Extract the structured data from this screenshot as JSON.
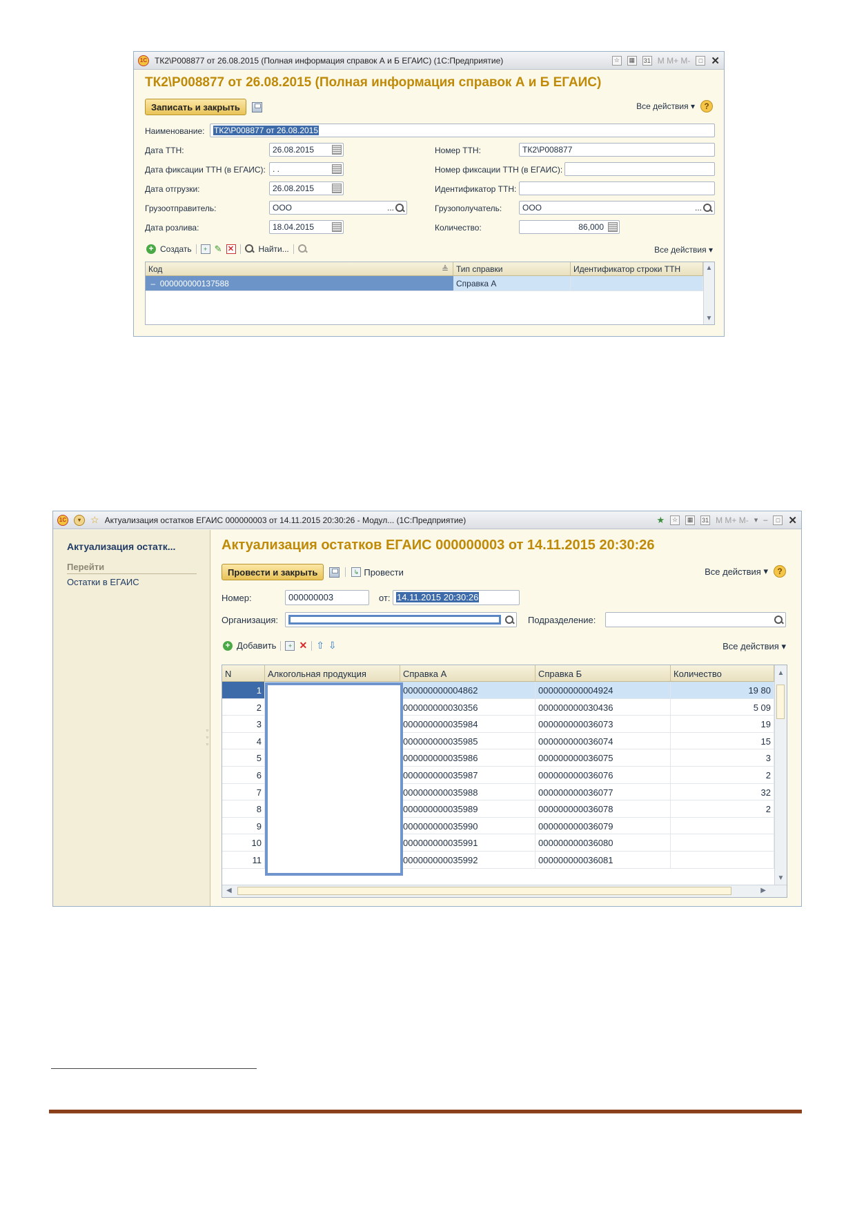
{
  "window1": {
    "titlebar_text": "ТК2\\Р008877 от 26.08.2015 (Полная информация справок А и Б ЕГАИС)  (1С:Предприятие)",
    "title": "ТК2\\Р008877 от 26.08.2015 (Полная информация справок А и Б ЕГАИС)",
    "save_close_label": "Записать и закрыть",
    "all_actions_label": "Все действия",
    "mm_label": "M  M+  M-",
    "fields": {
      "name_label": "Наименование:",
      "name_value": "ТК2\\Р008877 от 26.08.2015",
      "ttn_date_label": "Дата ТТН:",
      "ttn_date_value": "26.08.2015",
      "fix_date_label": "Дата фиксации ТТН (в ЕГАИС):",
      "fix_date_value": " .  .",
      "ship_date_label": "Дата отгрузки:",
      "ship_date_value": "26.08.2015",
      "shipper_label": "Грузоотправитель:",
      "shipper_value": "ООО",
      "bottling_date_label": "Дата розлива:",
      "bottling_date_value": "18.04.2015",
      "ttn_number_label": "Номер ТТН:",
      "ttn_number_value": "ТК2\\Р008877",
      "fix_number_label": "Номер фиксации ТТН (в ЕГАИС):",
      "fix_number_value": "",
      "ttn_id_label": "Идентификатор ТТН:",
      "ttn_id_value": "",
      "consignee_label": "Грузополучатель:",
      "consignee_value": "ООО",
      "quantity_label": "Количество:",
      "quantity_value": "86,000"
    },
    "toolbar": {
      "create_label": "Создать",
      "find_label": "Найти...",
      "all_actions_label": "Все действия"
    },
    "table": {
      "columns": [
        "Код",
        "Тип справки",
        "Идентификатор строки ТТН"
      ],
      "rows": [
        {
          "code": "000000000137588",
          "type": "Справка А",
          "id": ""
        }
      ]
    }
  },
  "window2": {
    "titlebar_text": "Актуализация остатков ЕГАИС 000000003 от 14.11.2015 20:30:26 - Модул...  (1С:Предприятие)",
    "title": "Актуализация остатков ЕГАИС 000000003 от 14.11.2015 20:30:26",
    "mm_label": "M  M+  M-",
    "left_panel": {
      "title": "Актуализация остатк...",
      "section": "Перейти",
      "link": "Остатки в ЕГАИС"
    },
    "post_close_label": "Провести и закрыть",
    "post_label": "Провести",
    "all_actions_label": "Все действия",
    "number_label": "Номер:",
    "number_value": "000000003",
    "from_label": "от:",
    "from_value": "14.11.2015 20:30:26",
    "org_label": "Организация:",
    "org_value": "",
    "dept_label": "Подразделение:",
    "dept_value": "",
    "toolbar": {
      "add_label": "Добавить",
      "all_actions_label": "Все действия"
    },
    "table": {
      "columns": [
        "N",
        "Алкогольная продукция",
        "Справка А",
        "Справка Б",
        "Количество"
      ],
      "rows": [
        {
          "n": "1",
          "prod": "",
          "a": "000000000004862",
          "b": "000000000004924",
          "qty": "19 80"
        },
        {
          "n": "2",
          "prod": "",
          "a": "000000000030356",
          "b": "000000000030436",
          "qty": "5 09"
        },
        {
          "n": "3",
          "prod": "",
          "a": "000000000035984",
          "b": "000000000036073",
          "qty": "19"
        },
        {
          "n": "4",
          "prod": "",
          "a": "000000000035985",
          "b": "000000000036074",
          "qty": "15"
        },
        {
          "n": "5",
          "prod": "",
          "a": "000000000035986",
          "b": "000000000036075",
          "qty": "3"
        },
        {
          "n": "6",
          "prod": "",
          "a": "000000000035987",
          "b": "000000000036076",
          "qty": "2"
        },
        {
          "n": "7",
          "prod": "",
          "a": "000000000035988",
          "b": "000000000036077",
          "qty": "32"
        },
        {
          "n": "8",
          "prod": "",
          "a": "000000000035989",
          "b": "000000000036078",
          "qty": "2"
        },
        {
          "n": "9",
          "prod": "",
          "a": "000000000035990",
          "b": "000000000036079",
          "qty": ""
        },
        {
          "n": "10",
          "prod": "",
          "a": "000000000035991",
          "b": "000000000036080",
          "qty": ""
        },
        {
          "n": "11",
          "prod": "",
          "a": "000000000035992",
          "b": "000000000036081",
          "qty": ""
        }
      ]
    }
  },
  "colors": {
    "title_gold": "#c08a09",
    "selection_blue": "#3d6aa8",
    "row_highlight": "#cfe3f7",
    "footer_line": "#8a3f1a"
  }
}
